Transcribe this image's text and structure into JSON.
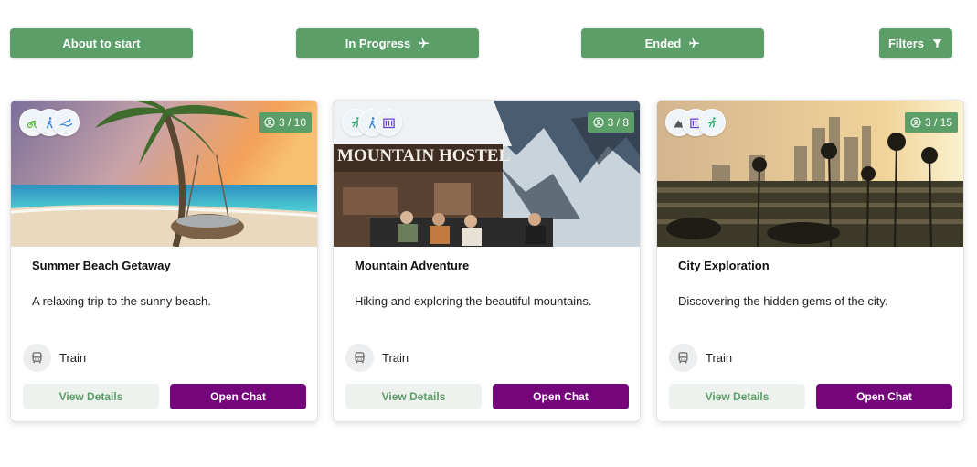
{
  "filters_bar": {
    "tabs": [
      {
        "label": "About to start",
        "icon": ""
      },
      {
        "label": "In Progress",
        "icon": "plane-icon"
      },
      {
        "label": "Ended",
        "icon": "plane-icon"
      }
    ],
    "filters_label": "Filters",
    "filters_icon": "funnel-icon"
  },
  "colors": {
    "primary_green": "#5b9e68",
    "chat_purple": "#74057a",
    "details_bg": "#eef2ee"
  },
  "trips": [
    {
      "title": "Summer Beach Getaway",
      "description": "A relaxing trip to the sunny beach.",
      "participants": "3 / 10",
      "activities": [
        "bicycle-icon",
        "walking-icon",
        "swimming-icon"
      ],
      "transport": "Train",
      "image": "beach-hammock-photo",
      "details_label": "View Details",
      "chat_label": "Open Chat"
    },
    {
      "title": "Mountain Adventure",
      "description": "Hiking and exploring the beautiful mountains.",
      "participants": "3 / 8",
      "activities": [
        "running-icon",
        "walking-icon",
        "museum-icon"
      ],
      "transport": "Train",
      "image": "mountain-hostel-photo",
      "image_sign": "MOUNTAIN HOSTEL",
      "details_label": "View Details",
      "chat_label": "Open Chat"
    },
    {
      "title": "City Exploration",
      "description": "Discovering the hidden gems of the city.",
      "participants": "3 / 15",
      "activities": [
        "mountain-icon",
        "museum-icon",
        "running-icon"
      ],
      "transport": "Train",
      "image": "city-skyline-palms-photo",
      "details_label": "View Details",
      "chat_label": "Open Chat"
    }
  ]
}
